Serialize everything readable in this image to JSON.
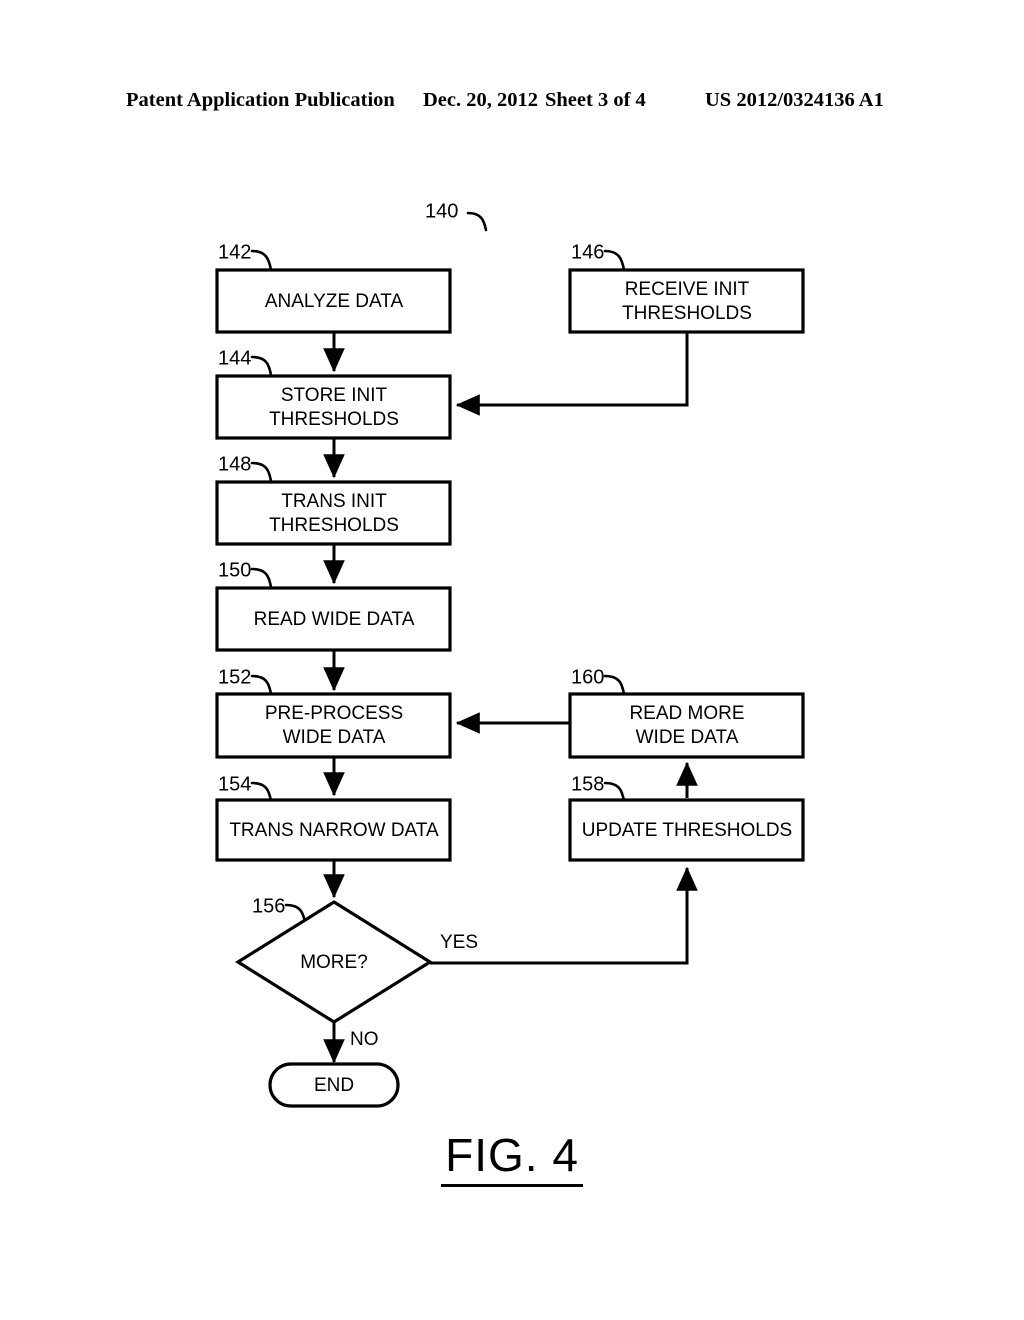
{
  "header": {
    "publication": "Patent Application Publication",
    "date": "Dec. 20, 2012",
    "sheet": "Sheet 3 of 4",
    "document_number": "US 2012/0324136 A1"
  },
  "figure": {
    "caption": "FIG. 4",
    "diagram_ref": "140",
    "nodes": {
      "n142": {
        "ref": "142",
        "line1": "ANALYZE DATA",
        "line2": ""
      },
      "n146": {
        "ref": "146",
        "line1": "RECEIVE INIT",
        "line2": "THRESHOLDS"
      },
      "n144": {
        "ref": "144",
        "line1": "STORE INIT",
        "line2": "THRESHOLDS"
      },
      "n148": {
        "ref": "148",
        "line1": "TRANS INIT",
        "line2": "THRESHOLDS"
      },
      "n150": {
        "ref": "150",
        "line1": "READ WIDE DATA",
        "line2": ""
      },
      "n152": {
        "ref": "152",
        "line1": "PRE-PROCESS",
        "line2": "WIDE DATA"
      },
      "n160": {
        "ref": "160",
        "line1": "READ MORE",
        "line2": "WIDE DATA"
      },
      "n154": {
        "ref": "154",
        "line1": "TRANS NARROW DATA",
        "line2": ""
      },
      "n158": {
        "ref": "158",
        "line1": "UPDATE THRESHOLDS",
        "line2": ""
      },
      "n156": {
        "ref": "156",
        "line1": "MORE?",
        "line2": ""
      },
      "nend": {
        "ref": "",
        "line1": "END",
        "line2": ""
      }
    },
    "edge_labels": {
      "yes": "YES",
      "no": "NO"
    }
  },
  "colors": {
    "ink": "#000000",
    "paper": "#ffffff"
  }
}
